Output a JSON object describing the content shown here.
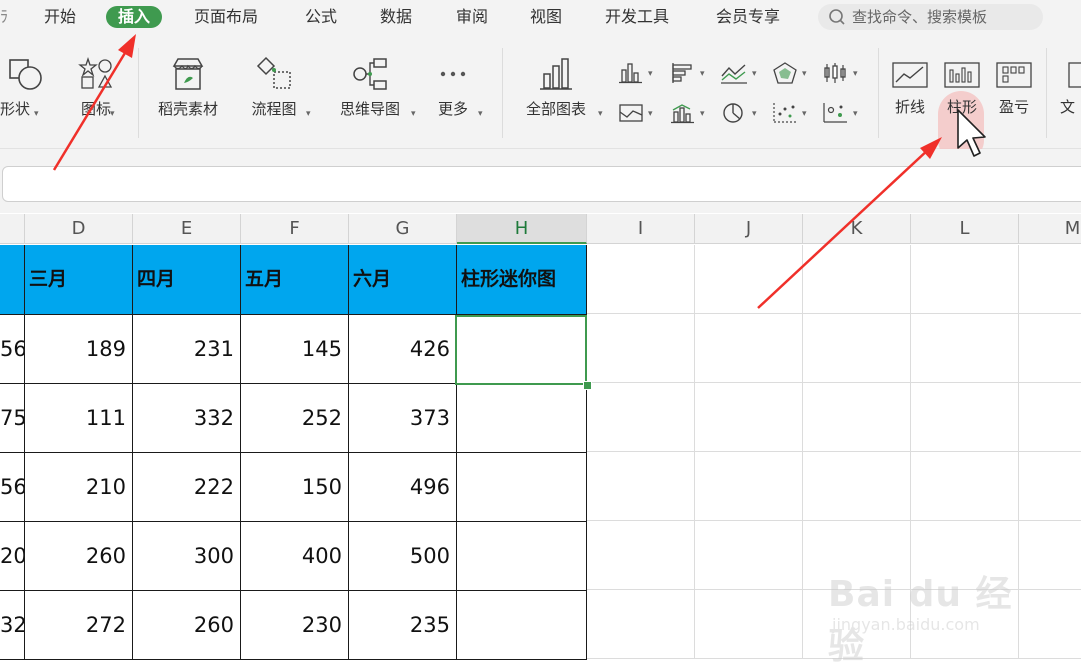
{
  "menu": {
    "items": [
      "开始",
      "插入",
      "页面布局",
      "公式",
      "数据",
      "审阅",
      "视图",
      "开发工具",
      "会员专享"
    ],
    "active": "插入",
    "search_placeholder": "查找命令、搜索模板"
  },
  "ribbon": {
    "shapes_label": "形状",
    "icons_label": "图标",
    "daoke_label": "稻壳素材",
    "flowchart_label": "流程图",
    "mindmap_label": "思维导图",
    "more_label": "更多",
    "all_charts_label": "全部图表",
    "sparkline_line_label": "折线",
    "sparkline_column_label": "柱形",
    "sparkline_winloss_label": "盈亏",
    "text_label_partial": "文"
  },
  "grid": {
    "columns": [
      "D",
      "E",
      "F",
      "G",
      "H",
      "I",
      "J",
      "K",
      "L",
      "M"
    ],
    "active_column": "H",
    "headers": [
      "三月",
      "四月",
      "五月",
      "六月",
      "柱形迷你图"
    ],
    "partial_c_values": [
      "56",
      "75",
      "56",
      "20",
      "32"
    ],
    "rows": [
      [
        "189",
        "231",
        "145",
        "426"
      ],
      [
        "111",
        "332",
        "252",
        "373"
      ],
      [
        "210",
        "222",
        "150",
        "496"
      ],
      [
        "260",
        "300",
        "400",
        "500"
      ],
      [
        "272",
        "260",
        "230",
        "235"
      ]
    ]
  },
  "watermark": {
    "brand": "Bai du 经验",
    "url": "jingyan.baidu.com"
  },
  "colors": {
    "accent_green": "#3f9a4f",
    "header_blue": "#00a6ee",
    "arrow_red": "#f0302a"
  }
}
